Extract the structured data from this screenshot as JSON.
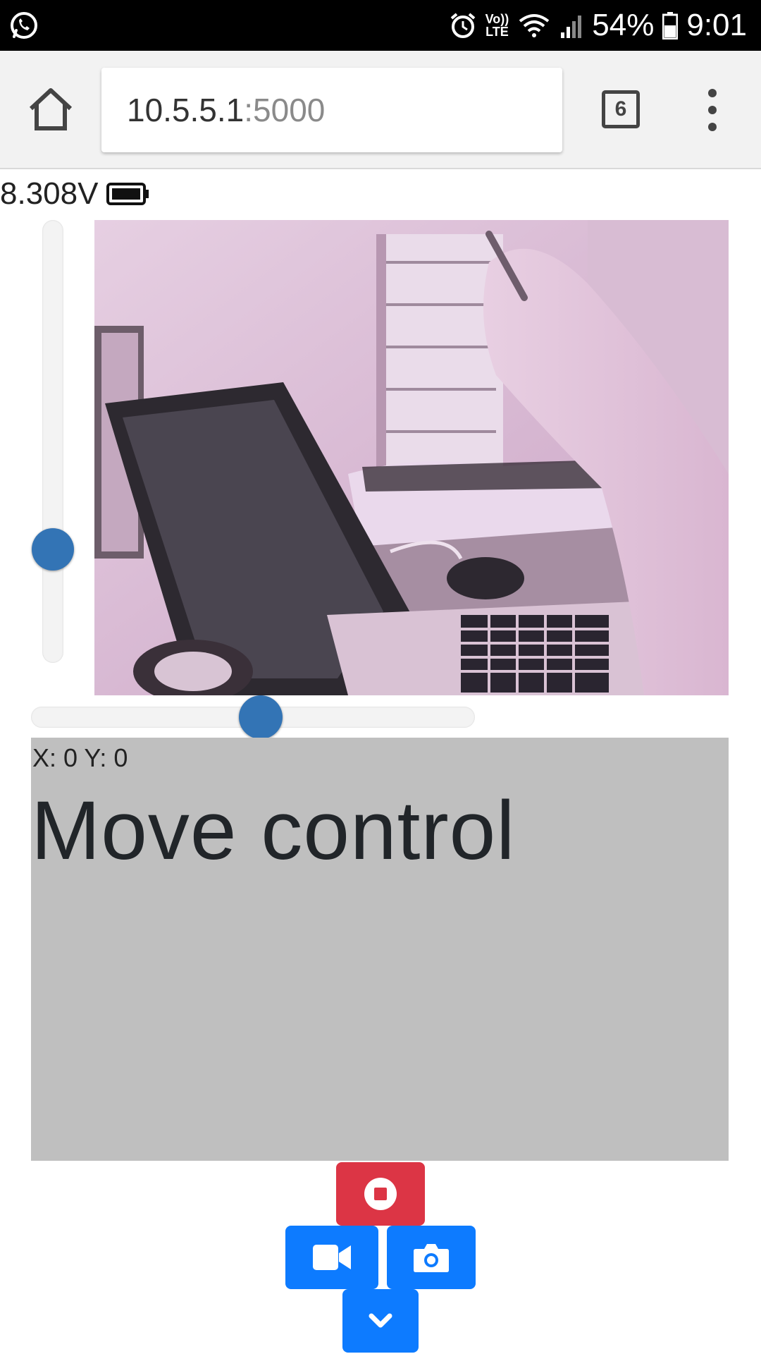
{
  "status_bar": {
    "battery_percent": "54%",
    "time": "9:01",
    "volte_label_top": "Vo))",
    "volte_label_bottom": "LTE",
    "icons": [
      "whatsapp-icon",
      "alarm-icon",
      "wifi-icon",
      "signal-icon",
      "battery-icon"
    ]
  },
  "browser": {
    "url_host": "10.5.5.1",
    "url_port": ":5000",
    "tab_count": "6",
    "icons": [
      "home-icon",
      "tabs-icon",
      "more-vert-icon"
    ]
  },
  "page": {
    "voltage": "8.308V",
    "vertical_slider_level": 0.23,
    "horizontal_slider_level": 0.52,
    "coords": "X: 0 Y: 0",
    "move_title": "Move control",
    "buttons": [
      {
        "name": "stop",
        "icon": "stop-circle-icon",
        "color": "#dc3545"
      },
      {
        "name": "video",
        "icon": "video-camera-icon",
        "color": "#0d7bff"
      },
      {
        "name": "photo",
        "icon": "camera-icon",
        "color": "#0d7bff"
      },
      {
        "name": "down",
        "icon": "chevron-down-icon",
        "color": "#0d7bff"
      }
    ],
    "colors": {
      "slider_thumb": "#3374b5",
      "move_pad": "#bfbfbf"
    }
  }
}
